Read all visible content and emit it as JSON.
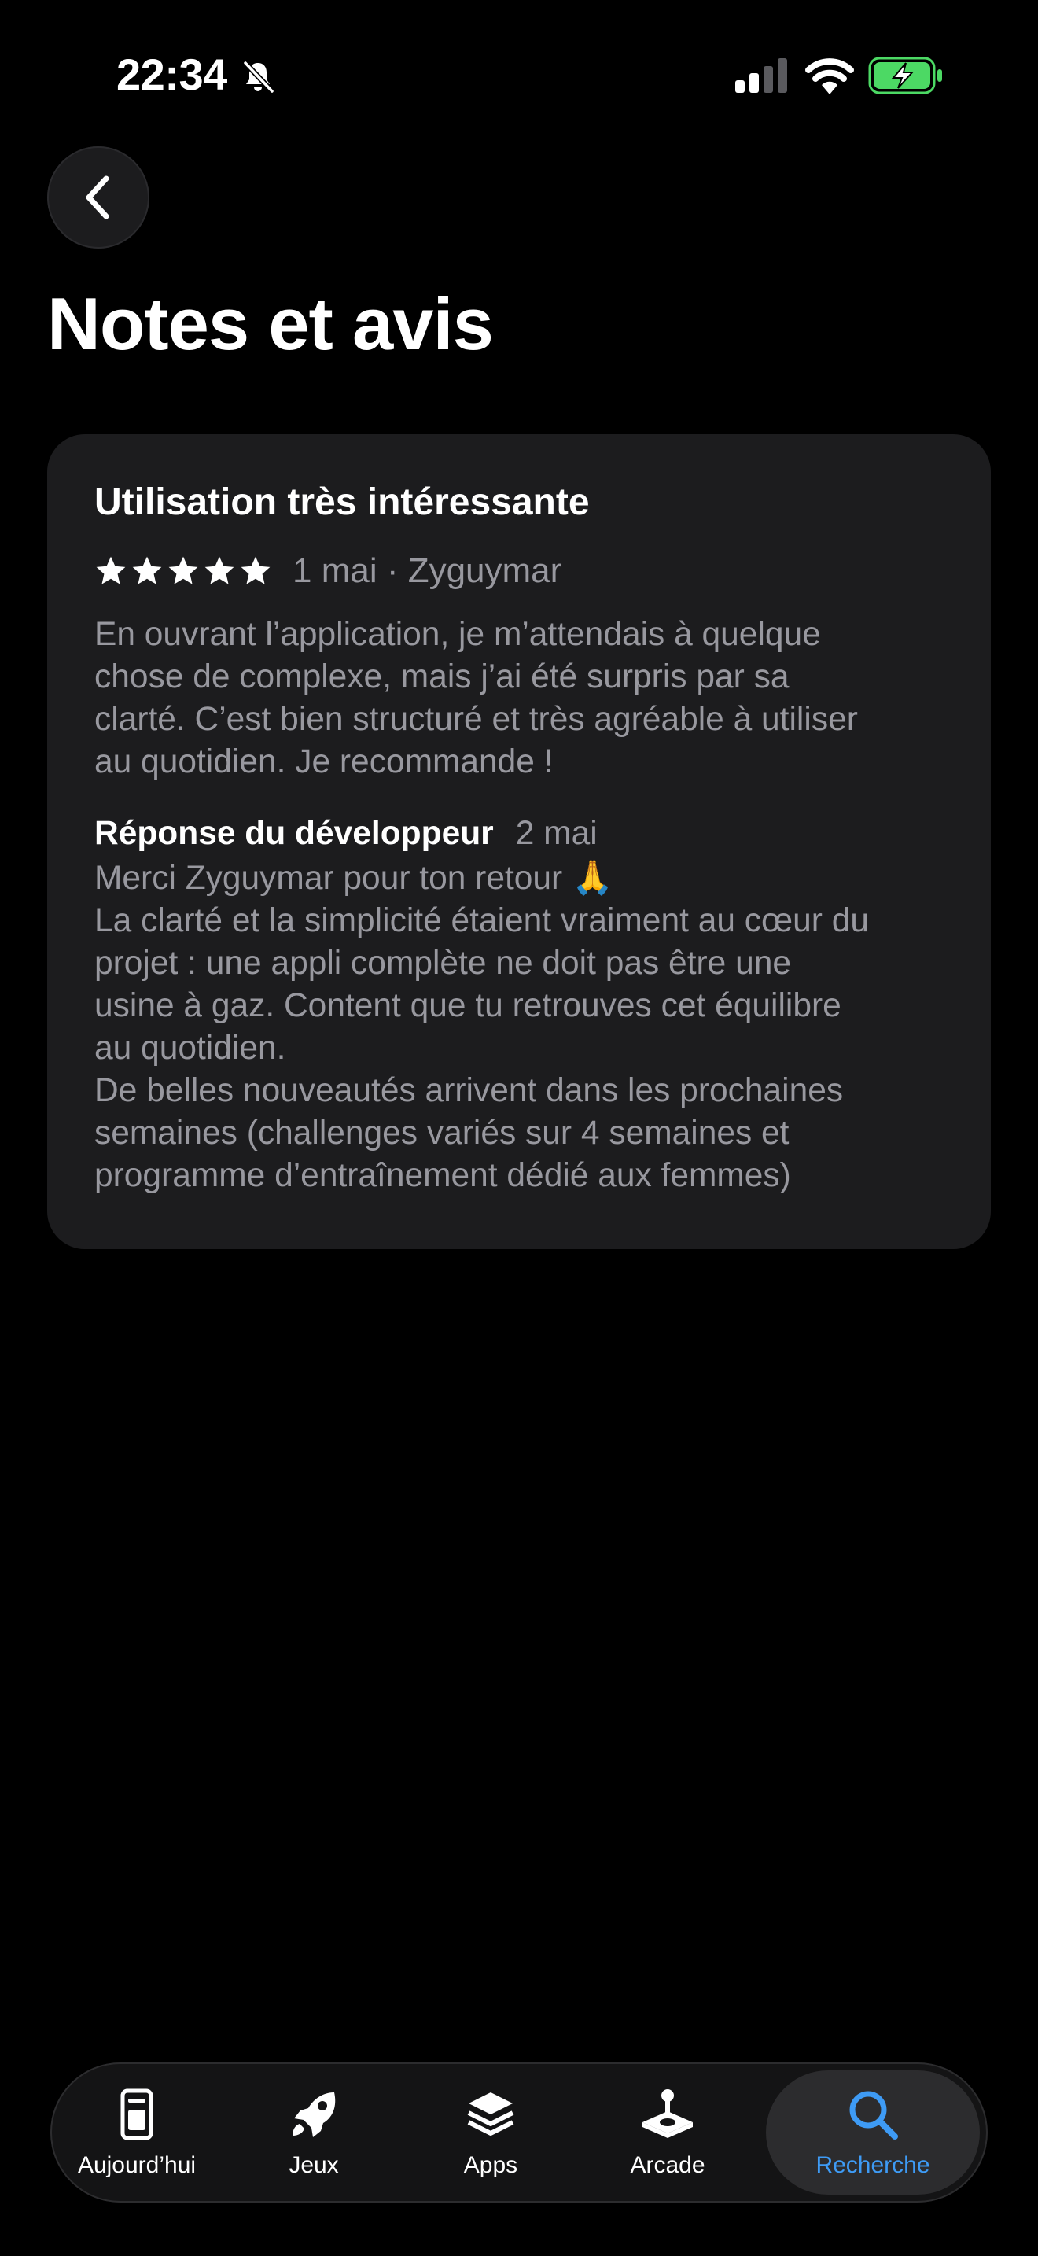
{
  "status_bar": {
    "time": "22:34"
  },
  "header": {
    "title": "Notes et avis"
  },
  "review": {
    "title": "Utilisation très intéressante",
    "rating": 5,
    "meta": "1 mai · Zyguymar",
    "body_lines": [
      "En ouvrant l’application, je m’attendais à quelque",
      "chose de complexe, mais j’ai été surpris par sa",
      "clarté. C’est bien structuré et très agréable à utiliser",
      "au quotidien. Je recommande !"
    ]
  },
  "developer_response": {
    "title": "Réponse du développeur",
    "date": "2 mai",
    "body_lines": [
      "Merci Zyguymar pour ton retour 🙏",
      "La clarté et la simplicité étaient vraiment au cœur du",
      "projet : une appli complète ne doit pas être une",
      "usine à gaz. Content que tu retrouves cet équilibre",
      "au quotidien.",
      "De belles nouveautés arrivent dans les prochaines",
      "semaines (challenges variés sur 4 semaines et",
      "programme d’entraînement dédié aux femmes)"
    ]
  },
  "tab_bar": {
    "tabs": [
      {
        "label": "Aujourd’hui",
        "icon": "today-icon"
      },
      {
        "label": "Jeux",
        "icon": "rocket-icon"
      },
      {
        "label": "Apps",
        "icon": "layers-icon"
      },
      {
        "label": "Arcade",
        "icon": "joystick-icon"
      },
      {
        "label": "Recherche",
        "icon": "search-icon"
      }
    ],
    "active": "Recherche"
  },
  "colors": {
    "background": "#000000",
    "card": "#1c1c1e",
    "secondary_text": "#98989f",
    "accent": "#3e9bf5",
    "battery_fill": "#4cd964"
  }
}
